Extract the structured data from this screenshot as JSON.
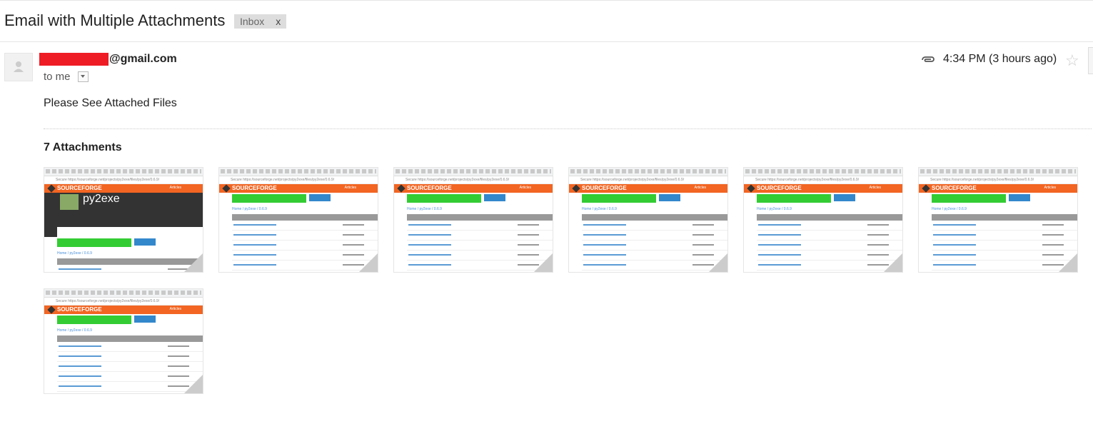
{
  "subject": "Email with Multiple Attachments",
  "label": {
    "name": "Inbox",
    "remove": "x"
  },
  "sender": {
    "domain": "@gmail.com"
  },
  "recipient": "to me",
  "timestamp": "4:34 PM (3 hours ago)",
  "star_glyph": "☆",
  "body": "Please See Attached Files",
  "attachments": {
    "count_label": "7 Attachments",
    "items": [
      {
        "kind": "py2exe-overview",
        "title": "py2exe"
      },
      {
        "kind": "file-listing"
      },
      {
        "kind": "file-listing"
      },
      {
        "kind": "file-listing"
      },
      {
        "kind": "file-listing"
      },
      {
        "kind": "file-listing"
      },
      {
        "kind": "file-listing"
      }
    ]
  },
  "thumb_text": {
    "address": "Secure  https://sourceforge.net/projects/py2exe/files/py2exe/0.6.9/",
    "brand": "SOURCEFORGE",
    "articles": "Articles",
    "crumb": "Home / py2exe / 0.6.9"
  },
  "icons": [
    "person-avatar-icon",
    "paperclip-icon",
    "star-icon",
    "chevron-down-icon"
  ]
}
